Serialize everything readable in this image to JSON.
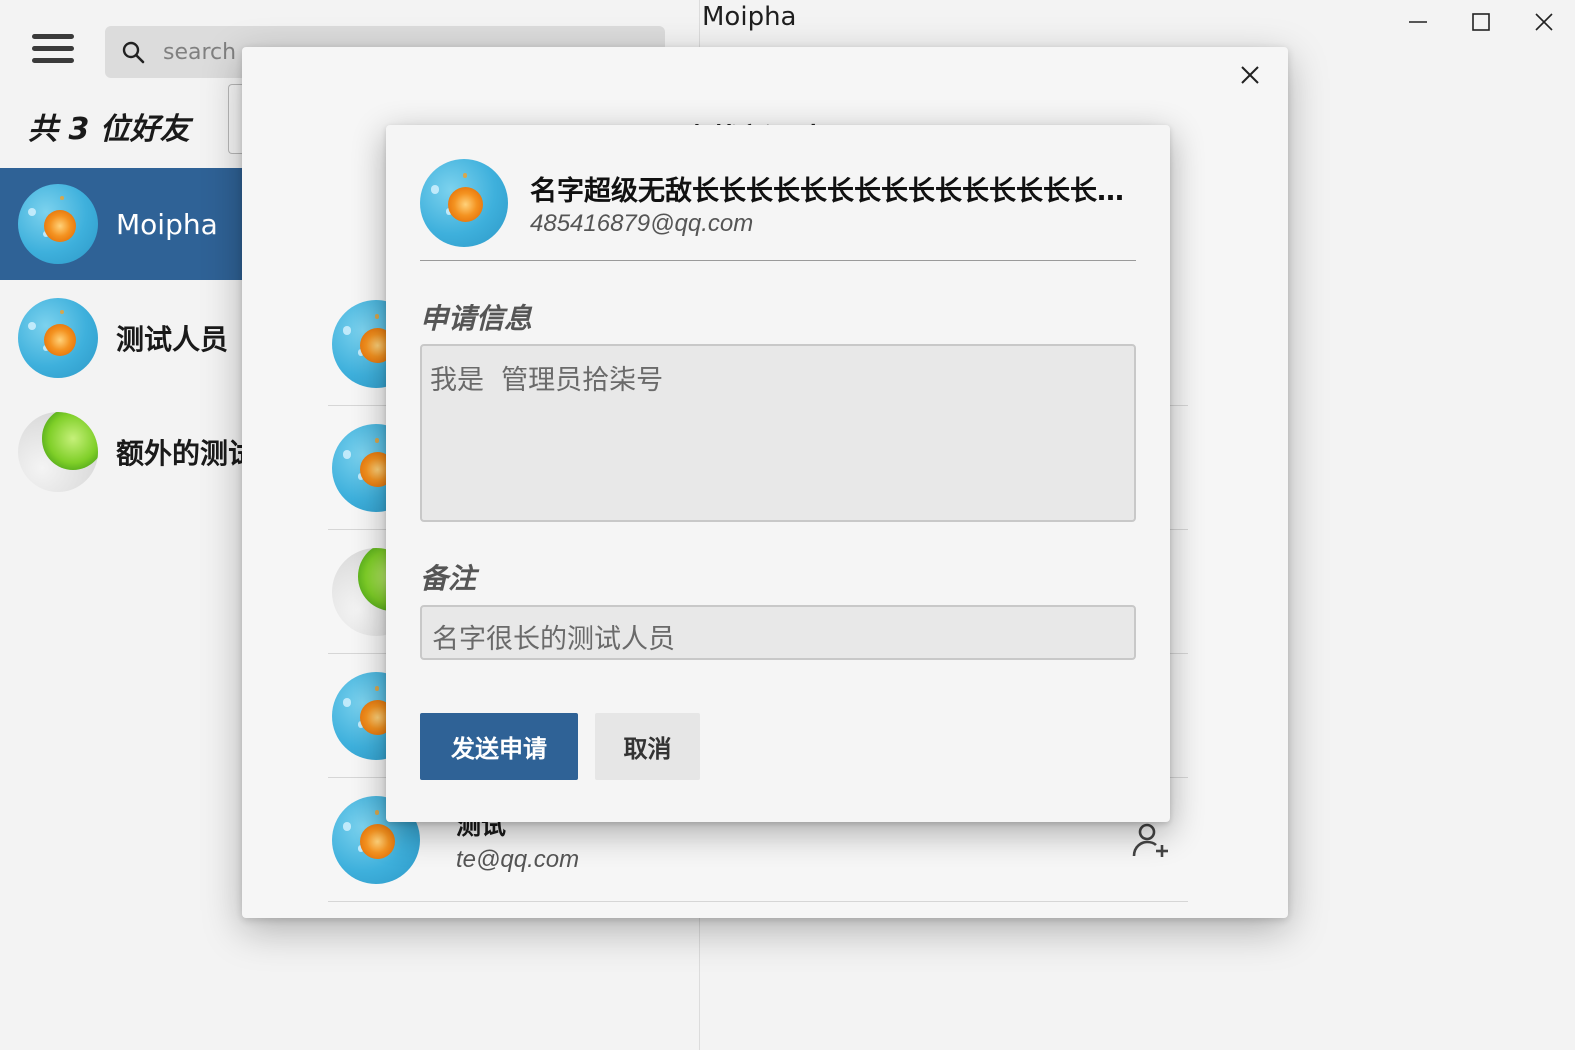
{
  "window": {
    "title": "Moipha",
    "controls": [
      "minimize-icon",
      "maximize-icon",
      "close-icon"
    ]
  },
  "sidebar": {
    "search_placeholder": "search",
    "friend_count": "共 3 位好友",
    "friends": [
      {
        "name": "Moipha",
        "avatar": "orange",
        "active": true
      },
      {
        "name": "测试人员",
        "avatar": "orange",
        "active": false
      },
      {
        "name": "额外的测试",
        "avatar": "lime",
        "active": false
      }
    ]
  },
  "find_dialog": {
    "title": "查找新朋友",
    "results": [
      {
        "name": "",
        "email": "",
        "avatar": "orange"
      },
      {
        "name": "",
        "email": "",
        "avatar": "orange"
      },
      {
        "name": "",
        "email": "",
        "avatar": "lime"
      },
      {
        "name": "",
        "email": "",
        "avatar": "orange"
      },
      {
        "name": "测试",
        "email": "te@qq.com",
        "avatar": "orange"
      }
    ]
  },
  "apply_dialog": {
    "name": "名字超级无敌长长长长长长长长长长长长长长长长长长长长",
    "email": "485416879@qq.com",
    "message_label": "申请信息",
    "message_value": "我是  管理员拾柒号",
    "remark_label": "备注",
    "remark_value": "名字很长的测试人员",
    "send_label": "发送申请",
    "cancel_label": "取消"
  },
  "colors": {
    "accent": "#2f6296",
    "background": "#f3f3f3",
    "input_bg": "#e8e8e8"
  }
}
